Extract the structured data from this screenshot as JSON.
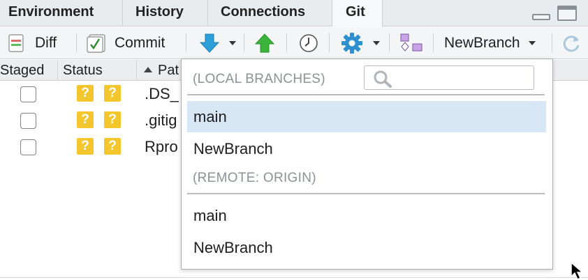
{
  "tabs": [
    {
      "label": "Environment",
      "active": false
    },
    {
      "label": "History",
      "active": false
    },
    {
      "label": "Connections",
      "active": false
    },
    {
      "label": "Git",
      "active": true
    }
  ],
  "toolbar": {
    "diff_label": "Diff",
    "commit_label": "Commit",
    "branch_label": "NewBranch"
  },
  "columns": {
    "staged": "Staged",
    "status": "Status",
    "path": "Pat"
  },
  "files": [
    {
      "path": ".DS_",
      "status_index": "?",
      "status_worktree": "?",
      "staged": false
    },
    {
      "path": ".gitig",
      "status_index": "?",
      "status_worktree": "?",
      "staged": false
    },
    {
      "path": "Rpro",
      "status_index": "?",
      "status_worktree": "?",
      "staged": false
    }
  ],
  "branch_dropdown": {
    "local_header": "(LOCAL BRANCHES)",
    "local_branches": [
      "main",
      "NewBranch"
    ],
    "selected_branch": "main",
    "remote_header": "(REMOTE: ORIGIN)",
    "remote_branches": [
      "main",
      "NewBranch"
    ],
    "search_placeholder": ""
  },
  "colors": {
    "status_badge": "#f2c62c",
    "selected_row": "#d7e7f5",
    "pull_arrow": "#2d9fd8",
    "push_arrow": "#3cb43c"
  }
}
